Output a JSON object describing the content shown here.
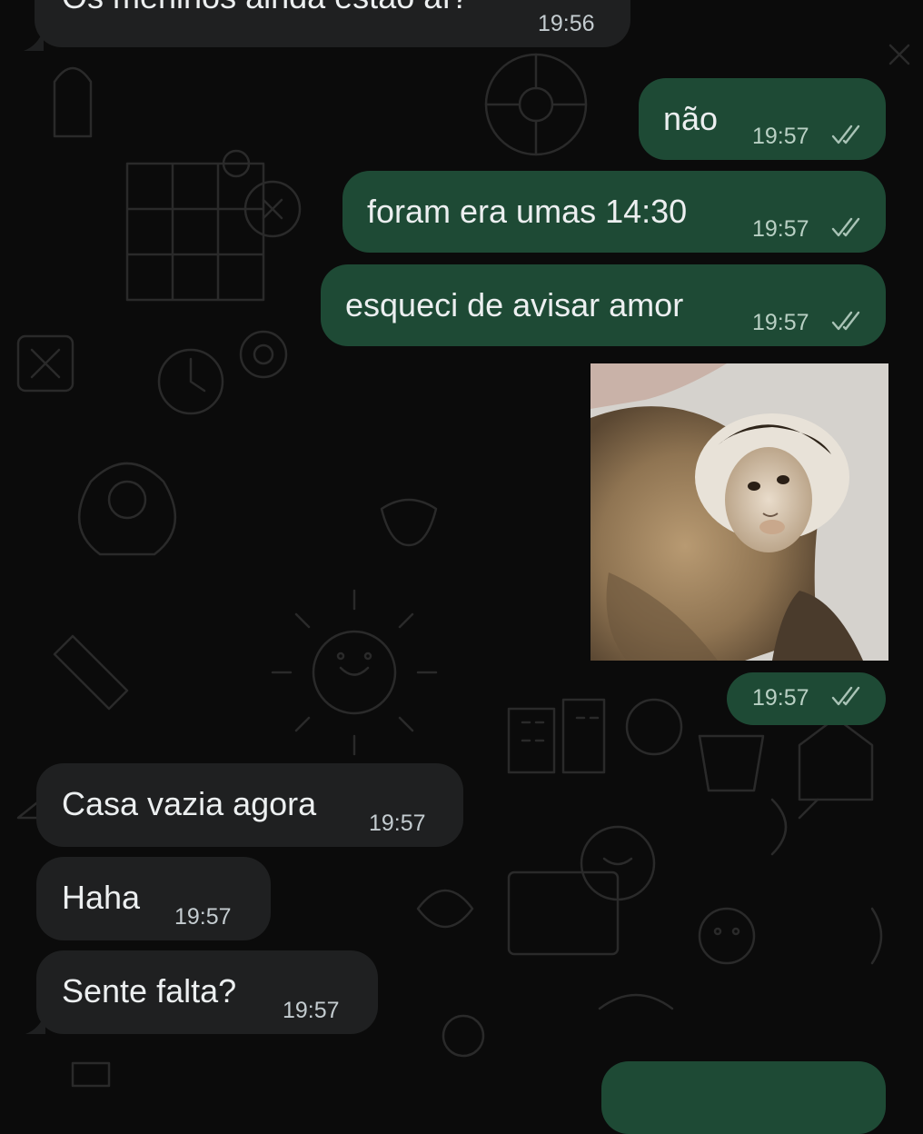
{
  "messages": [
    {
      "dir": "in",
      "text": "Os meninos ainda estão aí?",
      "time": "19:56"
    },
    {
      "dir": "out",
      "text": "não",
      "time": "19:57",
      "status": "read"
    },
    {
      "dir": "out",
      "text": "foram era umas 14:30",
      "time": "19:57",
      "status": "read"
    },
    {
      "dir": "out",
      "text": "esqueci de avisar amor",
      "time": "19:57",
      "status": "read"
    },
    {
      "dir": "out",
      "type": "image",
      "image": "capuchin-monkey-photo",
      "time": "19:57",
      "status": "read"
    },
    {
      "dir": "in",
      "text": "Casa vazia agora",
      "time": "19:57"
    },
    {
      "dir": "in",
      "text": "Haha",
      "time": "19:57"
    },
    {
      "dir": "in",
      "text": "Sente falta?",
      "time": "19:57"
    }
  ],
  "colors": {
    "incoming": "#1f2021",
    "outgoing": "#1e4a35",
    "background": "#0b0b0b",
    "read_ticks": "#a9c3b6"
  }
}
